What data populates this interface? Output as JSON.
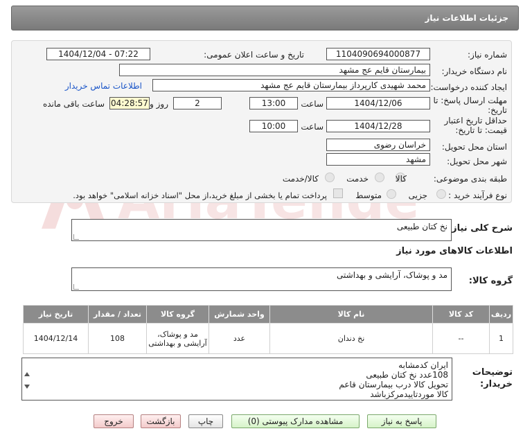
{
  "header": {
    "title": "جزئیات اطلاعات نیاز"
  },
  "form": {
    "need_number_label": "شماره نیاز:",
    "need_number": "1104090694000877",
    "announce_label": "تاریخ و ساعت اعلان عمومی:",
    "announce_value": "1404/12/04 - 07:22",
    "buyer_org_label": "نام دستگاه خریدار:",
    "buyer_org": "بیمارستان قایم  عج  مشهد",
    "creator_label": "ایجاد کننده درخواست:",
    "creator": "محمد شهیدی کارپرداز بیمارستان قایم  عج  مشهد",
    "contact_link": "اطلاعات تماس خریدار",
    "deadline_label_1": "مهلت ارسال پاسخ: تا",
    "deadline_label_2": "تاریخ:",
    "deadline_date": "1404/12/06",
    "time_label": "ساعت",
    "deadline_time": "13:00",
    "days_value": "2",
    "days_label": "روز و",
    "remaining_time": "04:28:57",
    "remaining_label": "ساعت باقی مانده",
    "validity_label_1": "حداقل تاریخ اعتبار",
    "validity_label_2": "قیمت: تا تاریخ:",
    "validity_date": "1404/12/28",
    "validity_time": "10:00",
    "province_label": "استان محل تحویل:",
    "province": "خراسان رضوی",
    "city_label": "شهر محل تحویل:",
    "city": "مشهد",
    "category_label": "طبقه بندی موضوعی:",
    "category_options": [
      "کالا",
      "خدمت",
      "کالا/خدمت"
    ],
    "process_label": "نوع فرآیند خرید :",
    "process_options": [
      "جزیی",
      "متوسط"
    ],
    "payment_note": "پرداخت تمام یا بخشی از مبلغ خرید،از محل \"اسناد خزانه اسلامی\" خواهد بود."
  },
  "summary": {
    "label": "شرح کلی نیاز:",
    "value": "نخ کتان طبیعی"
  },
  "goods_info": {
    "title": "اطلاعات کالاهای مورد نیاز",
    "group_label": "گروه کالا:",
    "group_value": "مد و پوشاک، آرایشی و بهداشتی"
  },
  "table": {
    "headers": [
      "ردیف",
      "کد کالا",
      "نام کالا",
      "واحد شمارش",
      "گروه کالا",
      "تعداد / مقدار",
      "تاریخ نیاز"
    ],
    "rows": [
      [
        "1",
        "--",
        "نخ دندان",
        "عدد",
        "مد و پوشاک، آرایشی و بهداشتی",
        "108",
        "1404/12/14"
      ]
    ]
  },
  "buyer_notes": {
    "label_1": "توضیحات",
    "label_2": "خریدار:",
    "lines": [
      "ایران کدمشابه",
      "108عدد نخ کتان طبیعی",
      "تحویل کالا درب بیمارستان قاعم",
      "کالا موردتاییدمرکزباشد"
    ]
  },
  "buttons": {
    "reply": "پاسخ به نیاز",
    "attachments": "مشاهده مدارک پیوستی (0)",
    "print": "چاپ",
    "back": "بازگشت",
    "exit": "خروج"
  },
  "watermark": {
    "text": "AriaTender.net"
  },
  "colors": {
    "header_bg": "#8c8c8c",
    "link": "#1a55c8",
    "remaining_bg": "#fffbd0"
  }
}
